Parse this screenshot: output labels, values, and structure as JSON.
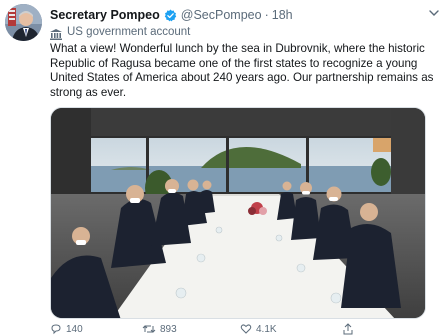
{
  "author": {
    "display_name": "Secretary Pompeo",
    "handle": "@SecPompeo",
    "separator": "·",
    "time": "18h",
    "verified": true
  },
  "label": {
    "text": "US government account",
    "icon": "government-building-icon"
  },
  "tweet_text": "What a view! Wonderful lunch by the sea in Dubrovnik, where the historic Republic of Ragusa became one of the first states to recognize a young United States of America about 240 years ago. Our partnership remains as strong as ever.",
  "actions": {
    "reply_count": "140",
    "retweet_count": "893",
    "like_count": "4.1K"
  },
  "colors": {
    "verified_blue": "#1da1f2",
    "secondary_text": "#5b6b7a",
    "sea": "#7f9cb3",
    "island": "#4e6d3a"
  }
}
